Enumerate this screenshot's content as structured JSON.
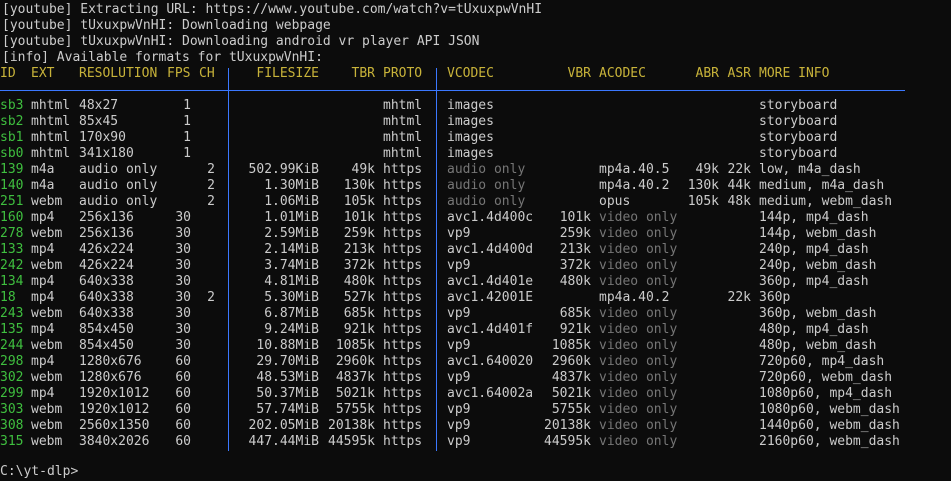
{
  "log_lines": [
    "[youtube] Extracting URL: https://www.youtube.com/watch?v=tUxuxpwVnHI",
    "[youtube] tUxuxpwVnHI: Downloading webpage",
    "[youtube] tUxuxpwVnHI: Downloading android vr player API JSON",
    "[info] Available formats for tUxuxpwVnHI:"
  ],
  "headers": {
    "id": "ID",
    "ext": "EXT",
    "resolution": "RESOLUTION",
    "fps": "FPS",
    "ch": "CH",
    "filesize": "FILESIZE",
    "tbr": "TBR",
    "proto": "PROTO",
    "vcodec": "VCODEC",
    "vbr": "VBR",
    "acodec": "ACODEC",
    "abr": "ABR",
    "asr": "ASR",
    "info": "MORE INFO"
  },
  "rows": [
    {
      "id": "sb3",
      "ext": "mhtml",
      "res": "48x27",
      "fps": "1",
      "ch": "",
      "size": "",
      "tbr": "",
      "proto": "mhtml",
      "vcodec": "images",
      "vbr": "",
      "acodec": "",
      "abr": "",
      "asr": "",
      "info": "storyboard"
    },
    {
      "id": "sb2",
      "ext": "mhtml",
      "res": "85x45",
      "fps": "1",
      "ch": "",
      "size": "",
      "tbr": "",
      "proto": "mhtml",
      "vcodec": "images",
      "vbr": "",
      "acodec": "",
      "abr": "",
      "asr": "",
      "info": "storyboard"
    },
    {
      "id": "sb1",
      "ext": "mhtml",
      "res": "170x90",
      "fps": "1",
      "ch": "",
      "size": "",
      "tbr": "",
      "proto": "mhtml",
      "vcodec": "images",
      "vbr": "",
      "acodec": "",
      "abr": "",
      "asr": "",
      "info": "storyboard"
    },
    {
      "id": "sb0",
      "ext": "mhtml",
      "res": "341x180",
      "fps": "1",
      "ch": "",
      "size": "",
      "tbr": "",
      "proto": "mhtml",
      "vcodec": "images",
      "vbr": "",
      "acodec": "",
      "abr": "",
      "asr": "",
      "info": "storyboard"
    },
    {
      "id": "139",
      "ext": "m4a",
      "res": "audio only",
      "fps": "",
      "ch": "2",
      "size": "502.99KiB",
      "tbr": "49k",
      "proto": "https",
      "vcodec": "audio only",
      "vbr": "",
      "acodec": "mp4a.40.5",
      "abr": "49k",
      "asr": "22k",
      "info": "low, m4a_dash"
    },
    {
      "id": "140",
      "ext": "m4a",
      "res": "audio only",
      "fps": "",
      "ch": "2",
      "size": "1.30MiB",
      "tbr": "130k",
      "proto": "https",
      "vcodec": "audio only",
      "vbr": "",
      "acodec": "mp4a.40.2",
      "abr": "130k",
      "asr": "44k",
      "info": "medium, m4a_dash"
    },
    {
      "id": "251",
      "ext": "webm",
      "res": "audio only",
      "fps": "",
      "ch": "2",
      "size": "1.06MiB",
      "tbr": "105k",
      "proto": "https",
      "vcodec": "audio only",
      "vbr": "",
      "acodec": "opus",
      "abr": "105k",
      "asr": "48k",
      "info": "medium, webm_dash"
    },
    {
      "id": "160",
      "ext": "mp4",
      "res": "256x136",
      "fps": "30",
      "ch": "",
      "size": "1.01MiB",
      "tbr": "101k",
      "proto": "https",
      "vcodec": "avc1.4d400c",
      "vbr": "101k",
      "acodec": "video only",
      "abr": "",
      "asr": "",
      "info": "144p, mp4_dash"
    },
    {
      "id": "278",
      "ext": "webm",
      "res": "256x136",
      "fps": "30",
      "ch": "",
      "size": "2.59MiB",
      "tbr": "259k",
      "proto": "https",
      "vcodec": "vp9",
      "vbr": "259k",
      "acodec": "video only",
      "abr": "",
      "asr": "",
      "info": "144p, webm_dash"
    },
    {
      "id": "133",
      "ext": "mp4",
      "res": "426x224",
      "fps": "30",
      "ch": "",
      "size": "2.14MiB",
      "tbr": "213k",
      "proto": "https",
      "vcodec": "avc1.4d400d",
      "vbr": "213k",
      "acodec": "video only",
      "abr": "",
      "asr": "",
      "info": "240p, mp4_dash"
    },
    {
      "id": "242",
      "ext": "webm",
      "res": "426x224",
      "fps": "30",
      "ch": "",
      "size": "3.74MiB",
      "tbr": "372k",
      "proto": "https",
      "vcodec": "vp9",
      "vbr": "372k",
      "acodec": "video only",
      "abr": "",
      "asr": "",
      "info": "240p, webm_dash"
    },
    {
      "id": "134",
      "ext": "mp4",
      "res": "640x338",
      "fps": "30",
      "ch": "",
      "size": "4.81MiB",
      "tbr": "480k",
      "proto": "https",
      "vcodec": "avc1.4d401e",
      "vbr": "480k",
      "acodec": "video only",
      "abr": "",
      "asr": "",
      "info": "360p, mp4_dash"
    },
    {
      "id": "18",
      "ext": "mp4",
      "res": "640x338",
      "fps": "30",
      "ch": "2",
      "size": "5.30MiB",
      "tbr": "527k",
      "proto": "https",
      "vcodec": "avc1.42001E",
      "vbr": "",
      "acodec": "mp4a.40.2",
      "abr": "",
      "asr": "22k",
      "info": "360p"
    },
    {
      "id": "243",
      "ext": "webm",
      "res": "640x338",
      "fps": "30",
      "ch": "",
      "size": "6.87MiB",
      "tbr": "685k",
      "proto": "https",
      "vcodec": "vp9",
      "vbr": "685k",
      "acodec": "video only",
      "abr": "",
      "asr": "",
      "info": "360p, webm_dash"
    },
    {
      "id": "135",
      "ext": "mp4",
      "res": "854x450",
      "fps": "30",
      "ch": "",
      "size": "9.24MiB",
      "tbr": "921k",
      "proto": "https",
      "vcodec": "avc1.4d401f",
      "vbr": "921k",
      "acodec": "video only",
      "abr": "",
      "asr": "",
      "info": "480p, mp4_dash"
    },
    {
      "id": "244",
      "ext": "webm",
      "res": "854x450",
      "fps": "30",
      "ch": "",
      "size": "10.88MiB",
      "tbr": "1085k",
      "proto": "https",
      "vcodec": "vp9",
      "vbr": "1085k",
      "acodec": "video only",
      "abr": "",
      "asr": "",
      "info": "480p, webm_dash"
    },
    {
      "id": "298",
      "ext": "mp4",
      "res": "1280x676",
      "fps": "60",
      "ch": "",
      "size": "29.70MiB",
      "tbr": "2960k",
      "proto": "https",
      "vcodec": "avc1.640020",
      "vbr": "2960k",
      "acodec": "video only",
      "abr": "",
      "asr": "",
      "info": "720p60, mp4_dash"
    },
    {
      "id": "302",
      "ext": "webm",
      "res": "1280x676",
      "fps": "60",
      "ch": "",
      "size": "48.53MiB",
      "tbr": "4837k",
      "proto": "https",
      "vcodec": "vp9",
      "vbr": "4837k",
      "acodec": "video only",
      "abr": "",
      "asr": "",
      "info": "720p60, webm_dash"
    },
    {
      "id": "299",
      "ext": "mp4",
      "res": "1920x1012",
      "fps": "60",
      "ch": "",
      "size": "50.37MiB",
      "tbr": "5021k",
      "proto": "https",
      "vcodec": "avc1.64002a",
      "vbr": "5021k",
      "acodec": "video only",
      "abr": "",
      "asr": "",
      "info": "1080p60, mp4_dash"
    },
    {
      "id": "303",
      "ext": "webm",
      "res": "1920x1012",
      "fps": "60",
      "ch": "",
      "size": "57.74MiB",
      "tbr": "5755k",
      "proto": "https",
      "vcodec": "vp9",
      "vbr": "5755k",
      "acodec": "video only",
      "abr": "",
      "asr": "",
      "info": "1080p60, webm_dash"
    },
    {
      "id": "308",
      "ext": "webm",
      "res": "2560x1350",
      "fps": "60",
      "ch": "",
      "size": "202.05MiB",
      "tbr": "20138k",
      "proto": "https",
      "vcodec": "vp9",
      "vbr": "20138k",
      "acodec": "video only",
      "abr": "",
      "asr": "",
      "info": "1440p60, webm_dash"
    },
    {
      "id": "315",
      "ext": "webm",
      "res": "3840x2026",
      "fps": "60",
      "ch": "",
      "size": "447.44MiB",
      "tbr": "44595k",
      "proto": "https",
      "vcodec": "vp9",
      "vbr": "44595k",
      "acodec": "video only",
      "abr": "",
      "asr": "",
      "info": "2160p60, webm_dash"
    }
  ],
  "prompt": "C:\\yt-dlp>",
  "colors": {
    "background": "#0c0c0c",
    "text": "#cccccc",
    "header": "#c8b33a",
    "format_id": "#3fbf3f",
    "separator": "#3b78ff",
    "dim": "#767676"
  }
}
